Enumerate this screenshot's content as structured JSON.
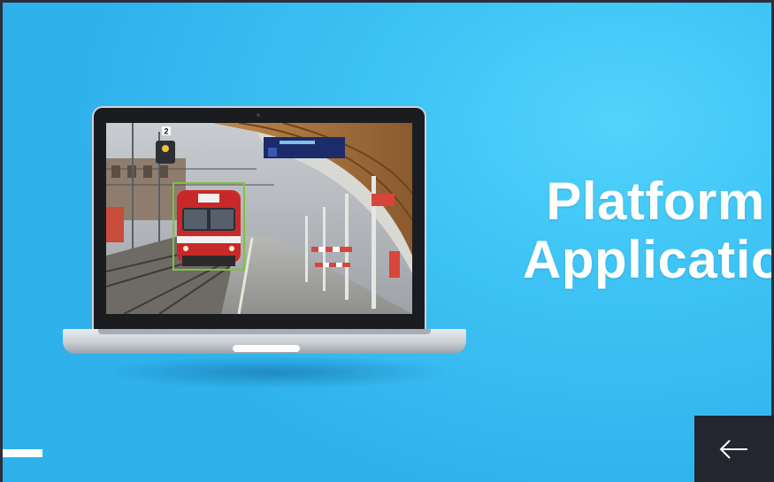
{
  "slide": {
    "title_line_1": "Platform",
    "title_line_2": "Application",
    "background_color": "#3fc4f5",
    "accent_color": "#ffffff"
  },
  "laptop": {
    "screen_image": "train-platform-detection",
    "detection_box_color": "#7ec242",
    "platform_number": "2"
  },
  "navigation": {
    "back_icon": "arrow-left-icon",
    "back_button_color": "#23262e"
  }
}
